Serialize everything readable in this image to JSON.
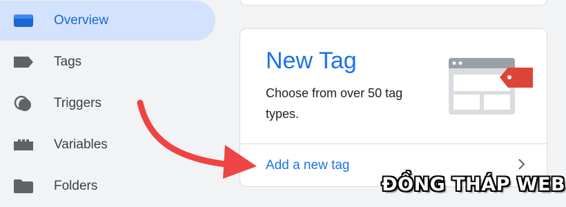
{
  "sidebar": {
    "items": [
      {
        "label": "Overview",
        "icon": "overview-icon",
        "active": true
      },
      {
        "label": "Tags",
        "icon": "tag-icon"
      },
      {
        "label": "Triggers",
        "icon": "triggers-icon"
      },
      {
        "label": "Variables",
        "icon": "variables-icon"
      },
      {
        "label": "Folders",
        "icon": "folder-icon"
      }
    ]
  },
  "new_tag_card": {
    "title": "New Tag",
    "description": "Choose from over 50 tag types.",
    "link_label": "Add a new tag",
    "illustration_icon": "tag-webpage-illustration",
    "chevron_icon": "chevron-right-icon"
  },
  "colors": {
    "accent": "#1a73e8",
    "active_bg": "#d3e3fd",
    "arrow": "#ef4444",
    "tag_red": "#db4437"
  },
  "watermark": {
    "text": "ĐỒNG THÁP WEB"
  }
}
